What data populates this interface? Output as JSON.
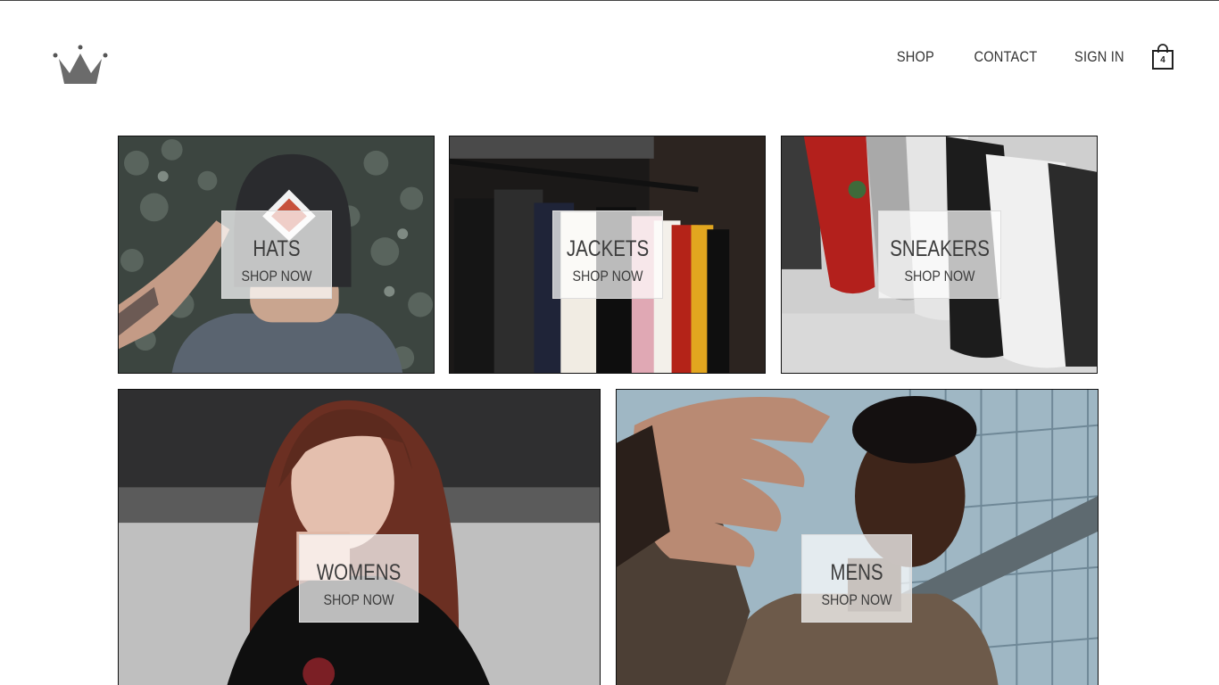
{
  "header": {
    "logo_icon": "crown-icon",
    "nav": [
      {
        "label": "SHOP"
      },
      {
        "label": "CONTACT"
      },
      {
        "label": "SIGN IN"
      }
    ],
    "cart": {
      "icon": "shopping-bag-icon",
      "count": "4"
    }
  },
  "categories": [
    {
      "title": "HATS",
      "cta": "SHOP NOW"
    },
    {
      "title": "JACKETS",
      "cta": "SHOP NOW"
    },
    {
      "title": "SNEAKERS",
      "cta": "SHOP NOW"
    },
    {
      "title": "WOMENS",
      "cta": "SHOP NOW"
    },
    {
      "title": "MENS",
      "cta": "SHOP NOW"
    }
  ]
}
